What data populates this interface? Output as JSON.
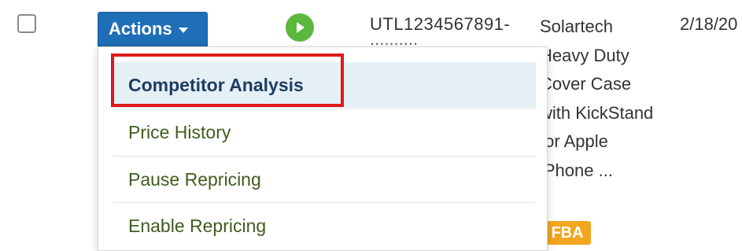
{
  "row": {
    "actions_label": "Actions",
    "sku": "UTL1234567891-",
    "sku_line2": "..........",
    "description": "Solartech Heavy Duty Cover Case with KickStand for Apple iPhone ...",
    "badge": "FBA",
    "date": "2/18/20"
  },
  "actions_menu": {
    "items": [
      {
        "label": "Competitor Analysis",
        "highlighted": true
      },
      {
        "label": "Price History"
      },
      {
        "label": "Pause Repricing"
      },
      {
        "label": "Enable Repricing"
      }
    ]
  },
  "colors": {
    "actions_button": "#1f6fb6",
    "play": "#5cb73d",
    "badge": "#f2a51d",
    "menu_text": "#3f5d1d",
    "highlight_box": "#e01a1a"
  },
  "icons": {
    "checkbox": "checkbox-icon",
    "caret": "caret-down-icon",
    "status": "play-icon"
  }
}
